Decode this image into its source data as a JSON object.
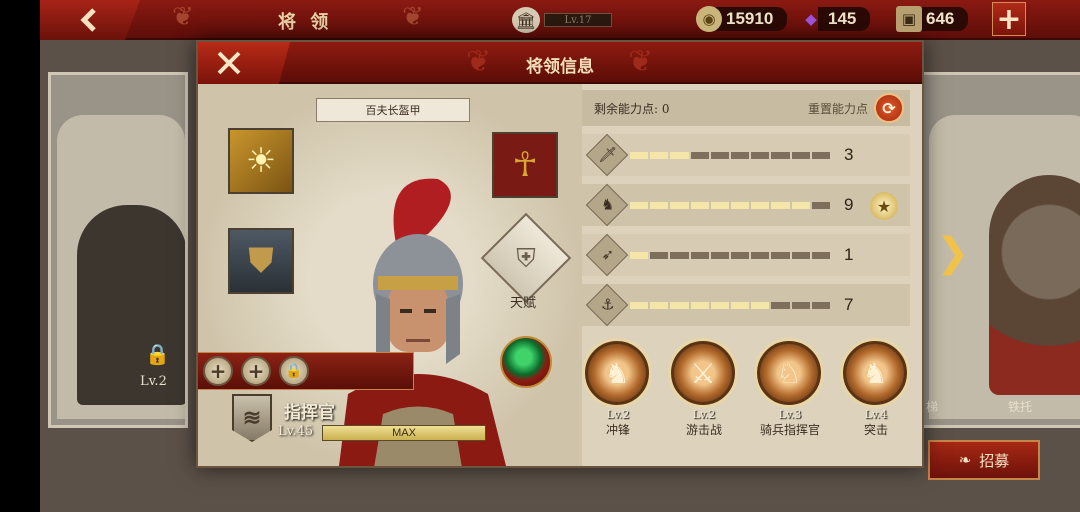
{
  "top_bar": {
    "title": "将 领",
    "player_level": "Lv.17",
    "resources": [
      {
        "icon": "coin-icon",
        "value": "15910"
      },
      {
        "icon": "crystal-icon",
        "value": "145"
      },
      {
        "icon": "iron-icon",
        "value": "646"
      }
    ]
  },
  "background": {
    "left_card_level": "Lv.2",
    "right_card_name_a": "梯",
    "right_card_name_b": "铁托",
    "recruit_label": "招募"
  },
  "modal": {
    "title": "将领信息",
    "equipment_name": "百夫长盔甲",
    "talent_label": "天赋",
    "hero_name": "指挥官",
    "hero_level": "Lv.45",
    "xp_label": "MAX",
    "remaining_points_label": "剩余能力点: 0",
    "reset_points_label": "重置能力点",
    "stats": [
      {
        "icon": "sword-icon",
        "value": "3",
        "level": 3,
        "max": 10
      },
      {
        "icon": "horse-icon",
        "value": "9",
        "level": 9,
        "max": 10,
        "star": true
      },
      {
        "icon": "bow-icon",
        "value": "1",
        "level": 1,
        "max": 10
      },
      {
        "icon": "anchor-icon",
        "value": "7",
        "level": 7,
        "max": 10
      }
    ],
    "skills": [
      {
        "level": "Lv.2",
        "name": "冲锋"
      },
      {
        "level": "Lv.2",
        "name": "游击战"
      },
      {
        "level": "Lv.3",
        "name": "骑兵指挥官"
      },
      {
        "level": "Lv.4",
        "name": "突击"
      }
    ]
  }
}
